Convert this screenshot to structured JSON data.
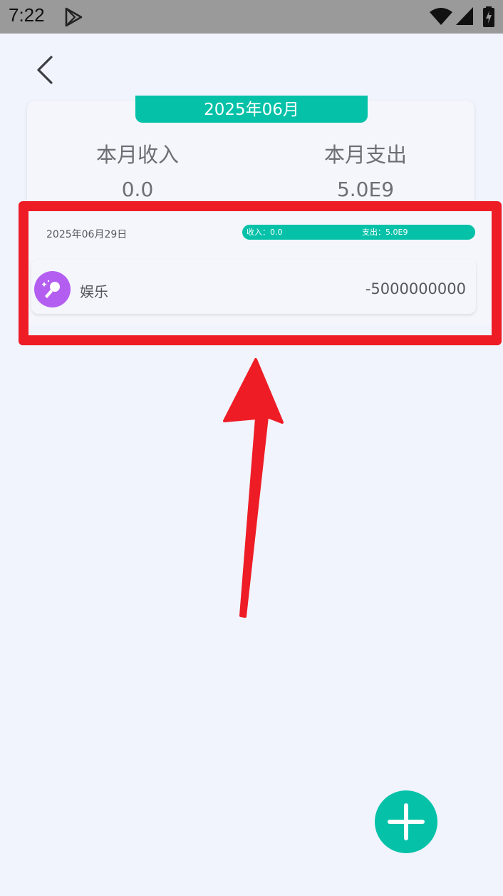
{
  "status_bar": {
    "time": "7:22",
    "icons": [
      "play-store-icon",
      "wifi-icon",
      "signal-icon",
      "battery-charging-icon"
    ]
  },
  "header": {
    "back_icon": "chevron-left-icon"
  },
  "summary": {
    "month": "2025年06月",
    "income_label": "本月收入",
    "income_value": "0.0",
    "expense_label": "本月支出",
    "expense_value": "5.0E9"
  },
  "day_group": {
    "date": "2025年06月29日",
    "income": "收入：0.0",
    "expense": "支出：5.0E9",
    "transactions": [
      {
        "icon": "microphone-icon",
        "category": "娱乐",
        "amount": "-5000000000"
      }
    ]
  },
  "fab": {
    "icon": "plus-icon"
  },
  "colors": {
    "accent": "#04c1a8",
    "category_purple": "#b45ef1",
    "annotation_red": "#ee1c25",
    "background": "#f1f4fd",
    "status_bar": "#9a9a9a"
  }
}
